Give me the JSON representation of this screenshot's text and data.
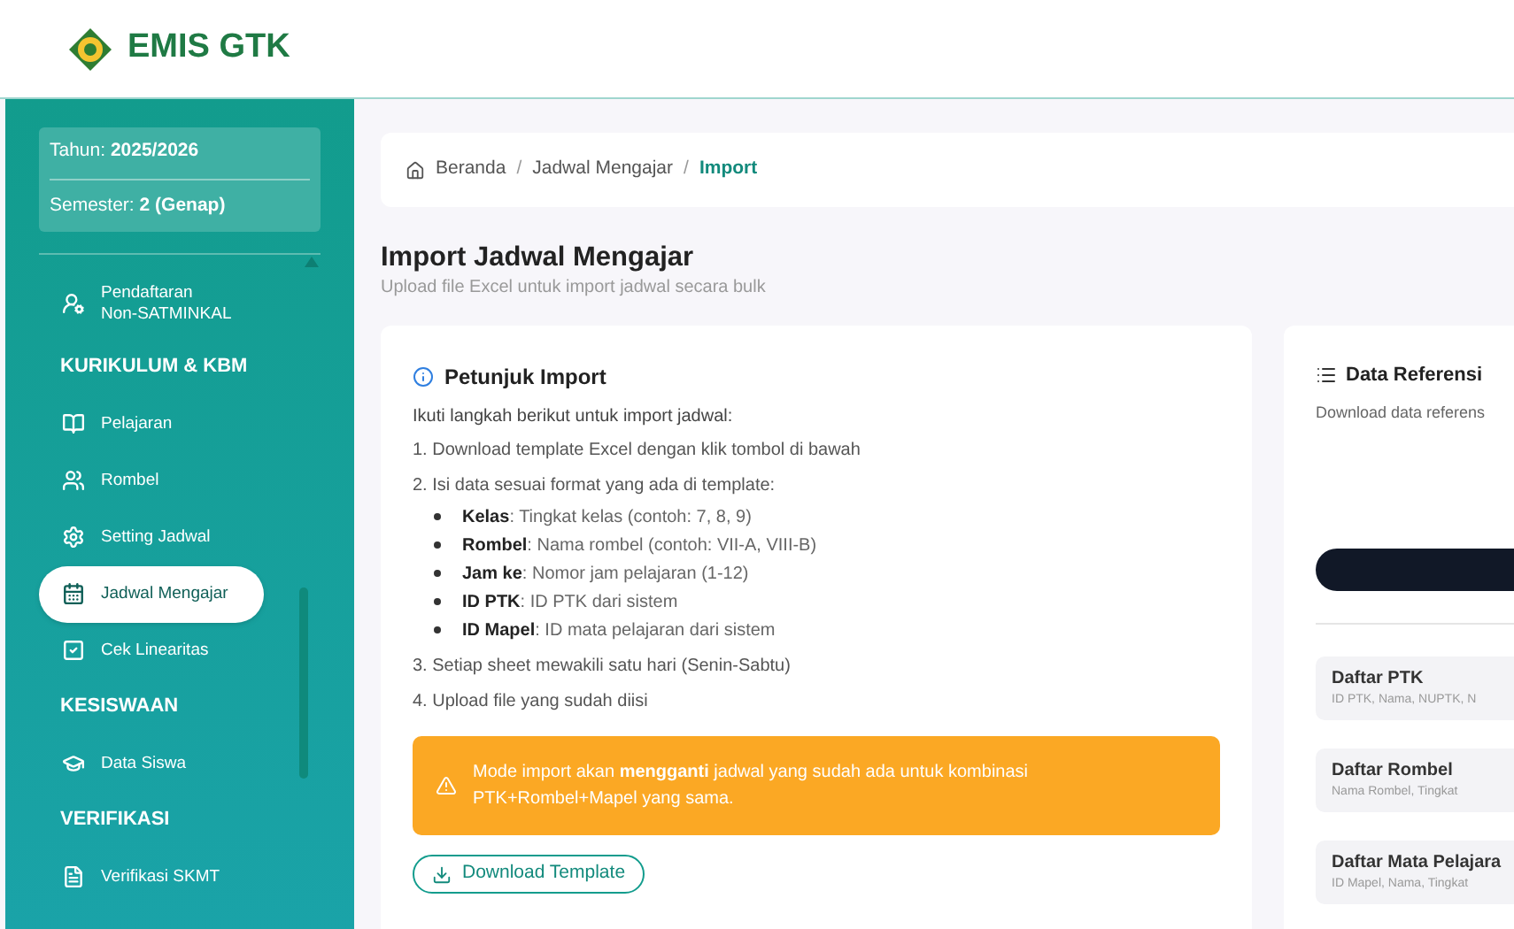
{
  "header": {
    "brand": "EMIS GTK"
  },
  "sidebar": {
    "year_label": "Tahun:",
    "year": "2025/2026",
    "semester_label": "Semester:",
    "semester": "2 (Genap)",
    "items": [
      {
        "kind": "item",
        "label": "Pendaftaran\nNon-SATMINKAL",
        "selected": false
      },
      {
        "kind": "header",
        "label": "KURIKULUM & KBM"
      },
      {
        "kind": "item",
        "label": "Pelajaran",
        "selected": false
      },
      {
        "kind": "item",
        "label": "Rombel",
        "selected": false
      },
      {
        "kind": "item",
        "label": "Setting Jadwal",
        "selected": false
      },
      {
        "kind": "item",
        "label": "Jadwal Mengajar",
        "selected": true
      },
      {
        "kind": "item",
        "label": "Cek Linearitas",
        "selected": false
      },
      {
        "kind": "header",
        "label": "KESISWAAN"
      },
      {
        "kind": "item",
        "label": "Data Siswa",
        "selected": false
      },
      {
        "kind": "header",
        "label": "VERIFIKASI"
      },
      {
        "kind": "item",
        "label": "Verifikasi SKMT",
        "selected": false
      }
    ]
  },
  "breadcrumb": [
    {
      "label": "Beranda",
      "current": false
    },
    {
      "separator": "/",
      "label": "Jadwal Mengajar",
      "current": false
    },
    {
      "separator": "/",
      "label": "Import",
      "current": true
    }
  ],
  "page": {
    "title": "Import Jadwal Mengajar",
    "subtitle": "Upload file Excel untuk import jadwal secara bulk"
  },
  "instructions": {
    "title": "Petunjuk Import",
    "intro": "Ikuti langkah berikut untuk import jadwal:",
    "steps": [
      {
        "text": "1. Download template Excel dengan klik tombol di bawah"
      },
      {
        "text": "2. Isi data sesuai format yang ada di template:",
        "bullets": [
          "**Kelas**: Tingkat kelas (contoh: 7, 8, 9)",
          "**Rombel**: Nama rombel (contoh: VII-A, VIII-B)",
          "**Jam ke**: Nomor jam pelajaran (1-12)",
          "**ID PTK**: ID PTK dari sistem",
          "**ID Mapel**: ID mata pelajaran dari sistem"
        ]
      },
      {
        "text": "3. Setiap sheet mewakili satu hari (Senin-Sabtu)"
      },
      {
        "text": "4. Upload file yang sudah diisi"
      }
    ],
    "alert": "Mode import akan **mengganti** jadwal yang sudah ada untuk kombinasi PTK+Rombel+Mapel yang sama.",
    "button": "Download Template"
  },
  "reference": {
    "title": "Data Referensi",
    "subtitle": "Download data referens",
    "items": [
      {
        "title": "Daftar PTK",
        "detail": "ID PTK, Nama, NUPTK, N"
      },
      {
        "title": "Daftar Rombel",
        "detail": "Nama Rombel, Tingkat"
      },
      {
        "title": "Daftar Mata Pelajara",
        "detail": "ID Mapel, Nama, Tingkat"
      }
    ]
  }
}
